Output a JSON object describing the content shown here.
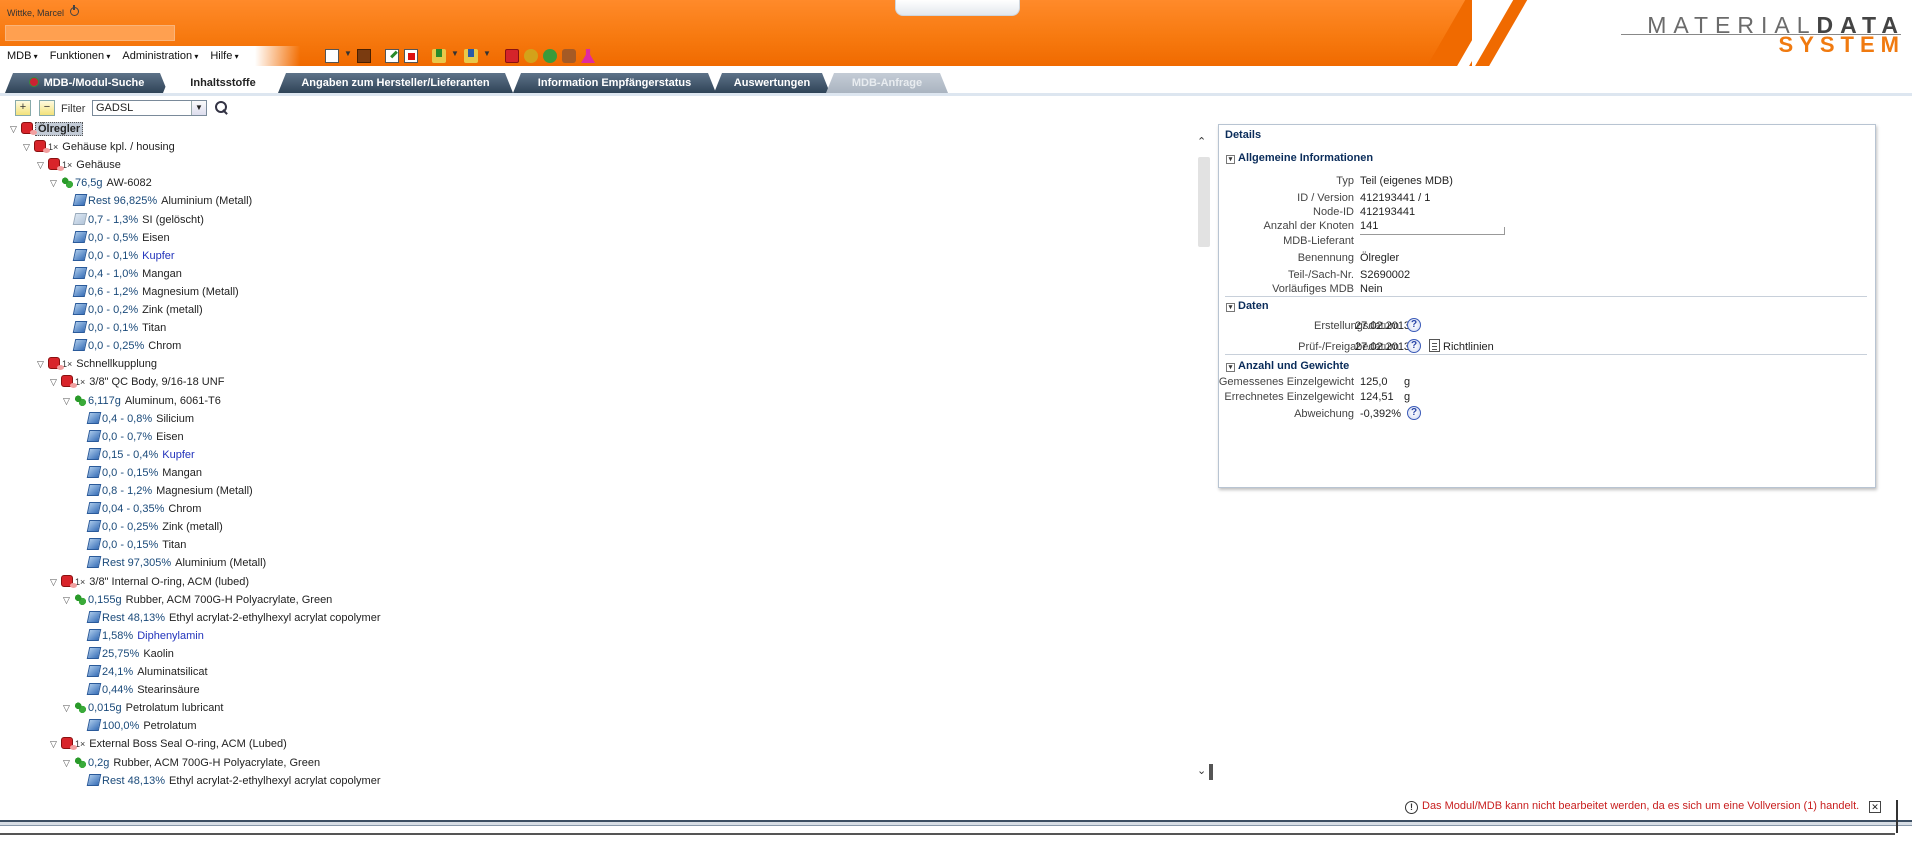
{
  "user": {
    "name": "Wittke, Marcel"
  },
  "menu": [
    "MDB",
    "Funktionen",
    "Administration",
    "Hilfe"
  ],
  "logo": {
    "line1_regular": "MATERIAL",
    "line1_bold": "DATA",
    "line2": "SYSTEM"
  },
  "tabs": [
    {
      "label": "MDB-/Modul-Suche",
      "state": "normal"
    },
    {
      "label": "Inhaltsstoffe",
      "state": "active"
    },
    {
      "label": "Angaben zum Hersteller/Lieferanten",
      "state": "normal"
    },
    {
      "label": "Information Empfängerstatus",
      "state": "normal"
    },
    {
      "label": "Auswertungen",
      "state": "normal"
    },
    {
      "label": "MDB-Anfrage",
      "state": "disabled"
    }
  ],
  "filter": {
    "label": "Filter",
    "value": "GADSL"
  },
  "tree": [
    {
      "indent": 0,
      "icon": "part",
      "mult": "",
      "qty": "",
      "name": "Ölregler",
      "selected": true
    },
    {
      "indent": 1,
      "icon": "part",
      "mult": "1×",
      "qty": "",
      "name": "Gehäuse kpl. / housing"
    },
    {
      "indent": 2,
      "icon": "part",
      "mult": "1×",
      "qty": "",
      "name": "Gehäuse"
    },
    {
      "indent": 3,
      "icon": "mat",
      "mult": "",
      "qty": "76,5g",
      "name": "AW-6082"
    },
    {
      "indent": 4,
      "icon": "sub",
      "qty": "Rest 96,825%",
      "name": "Aluminium (Metall)"
    },
    {
      "indent": 4,
      "icon": "subdel",
      "qty": "0,7 - 1,3%",
      "name": "SI (gelöscht)"
    },
    {
      "indent": 4,
      "icon": "sub",
      "qty": "0,0 - 0,5%",
      "name": "Eisen"
    },
    {
      "indent": 4,
      "icon": "sub",
      "qty": "0,0 - 0,1%",
      "name": "Kupfer",
      "link": true
    },
    {
      "indent": 4,
      "icon": "sub",
      "qty": "0,4 - 1,0%",
      "name": "Mangan"
    },
    {
      "indent": 4,
      "icon": "sub",
      "qty": "0,6 - 1,2%",
      "name": "Magnesium (Metall)"
    },
    {
      "indent": 4,
      "icon": "sub",
      "qty": "0,0 - 0,2%",
      "name": "Zink (metall)"
    },
    {
      "indent": 4,
      "icon": "sub",
      "qty": "0,0 - 0,1%",
      "name": "Titan"
    },
    {
      "indent": 4,
      "icon": "sub",
      "qty": "0,0 - 0,25%",
      "name": "Chrom"
    },
    {
      "indent": 2,
      "icon": "part",
      "mult": "1×",
      "qty": "",
      "name": "Schnellkupplung"
    },
    {
      "indent": 3,
      "icon": "part",
      "mult": "1×",
      "qty": "",
      "name": "3/8\" QC Body, 9/16-18 UNF"
    },
    {
      "indent": 4,
      "icon": "mat",
      "qty": "6,117g",
      "name": "Aluminum, 6061-T6"
    },
    {
      "indent": 5,
      "icon": "sub",
      "qty": "0,4 - 0,8%",
      "name": "Silicium"
    },
    {
      "indent": 5,
      "icon": "sub",
      "qty": "0,0 - 0,7%",
      "name": "Eisen"
    },
    {
      "indent": 5,
      "icon": "sub",
      "qty": "0,15 - 0,4%",
      "name": "Kupfer",
      "link": true
    },
    {
      "indent": 5,
      "icon": "sub",
      "qty": "0,0 - 0,15%",
      "name": "Mangan"
    },
    {
      "indent": 5,
      "icon": "sub",
      "qty": "0,8 - 1,2%",
      "name": "Magnesium (Metall)"
    },
    {
      "indent": 5,
      "icon": "sub",
      "qty": "0,04 - 0,35%",
      "name": "Chrom"
    },
    {
      "indent": 5,
      "icon": "sub",
      "qty": "0,0 - 0,25%",
      "name": "Zink (metall)"
    },
    {
      "indent": 5,
      "icon": "sub",
      "qty": "0,0 - 0,15%",
      "name": "Titan"
    },
    {
      "indent": 5,
      "icon": "sub",
      "qty": "Rest 97,305%",
      "name": "Aluminium (Metall)"
    },
    {
      "indent": 3,
      "icon": "part",
      "mult": "1×",
      "qty": "",
      "name": "3/8\" Internal O-ring, ACM (lubed)"
    },
    {
      "indent": 4,
      "icon": "mat",
      "qty": "0,155g",
      "name": "Rubber, ACM 700G-H Polyacrylate, Green"
    },
    {
      "indent": 5,
      "icon": "sub",
      "qty": "Rest 48,13%",
      "name": "Ethyl acrylat-2-ethylhexyl acrylat copolymer"
    },
    {
      "indent": 5,
      "icon": "sub",
      "qty": "1,58%",
      "name": "Diphenylamin",
      "link": true
    },
    {
      "indent": 5,
      "icon": "sub",
      "qty": "25,75%",
      "name": "Kaolin"
    },
    {
      "indent": 5,
      "icon": "sub",
      "qty": "24,1%",
      "name": "Aluminatsilicat"
    },
    {
      "indent": 5,
      "icon": "sub",
      "qty": "0,44%",
      "name": "Stearinsäure"
    },
    {
      "indent": 4,
      "icon": "mat",
      "qty": "0,015g",
      "name": "Petrolatum lubricant"
    },
    {
      "indent": 5,
      "icon": "sub",
      "qty": "100,0%",
      "name": "Petrolatum"
    },
    {
      "indent": 3,
      "icon": "part",
      "mult": "1×",
      "qty": "",
      "name": "External Boss Seal O-ring, ACM (Lubed)"
    },
    {
      "indent": 4,
      "icon": "mat",
      "qty": "0,2g",
      "name": "Rubber, ACM 700G-H Polyacrylate, Green"
    },
    {
      "indent": 5,
      "icon": "sub",
      "qty": "Rest 48,13%",
      "name": "Ethyl acrylat-2-ethylhexyl acrylat copolymer"
    }
  ],
  "details": {
    "title": "Details",
    "sections": {
      "general": {
        "heading": "Allgemeine Informationen",
        "rows": [
          {
            "label": "Typ",
            "value": "Teil (eigenes MDB)"
          },
          {
            "label": "ID / Version",
            "value": "412193441 / 1"
          },
          {
            "label": "Node-ID",
            "value": "412193441"
          },
          {
            "label": "Anzahl der Knoten",
            "value": "141"
          },
          {
            "label": "MDB-Lieferant",
            "value": ""
          },
          {
            "label": "Benennung",
            "value": "Ölregler"
          },
          {
            "label": "Teil-/Sach-Nr.",
            "value": "S2690002"
          },
          {
            "label": "Vorläufiges MDB",
            "value": "Nein"
          }
        ]
      },
      "dates": {
        "heading": "Daten",
        "rows": [
          {
            "label": "Erstellungsdatum",
            "value": "27.02.2013"
          },
          {
            "label": "Prüf-/Freigabedatum",
            "value": "27.02.2013"
          }
        ],
        "guidelines_label": "Richtlinien"
      },
      "weights": {
        "heading": "Anzahl und Gewichte",
        "rows": [
          {
            "label": "Gemessenes Einzelgewicht",
            "value": "125,0",
            "unit": "g"
          },
          {
            "label": "Errechnetes Einzelgewicht",
            "value": "124,51",
            "unit": "g"
          },
          {
            "label": "Abweichung",
            "value": "-0,392%",
            "unit": ""
          }
        ]
      }
    }
  },
  "status_message": "Das Modul/MDB kann nicht bearbeitet werden, da es sich um eine Vollversion (1) handelt."
}
